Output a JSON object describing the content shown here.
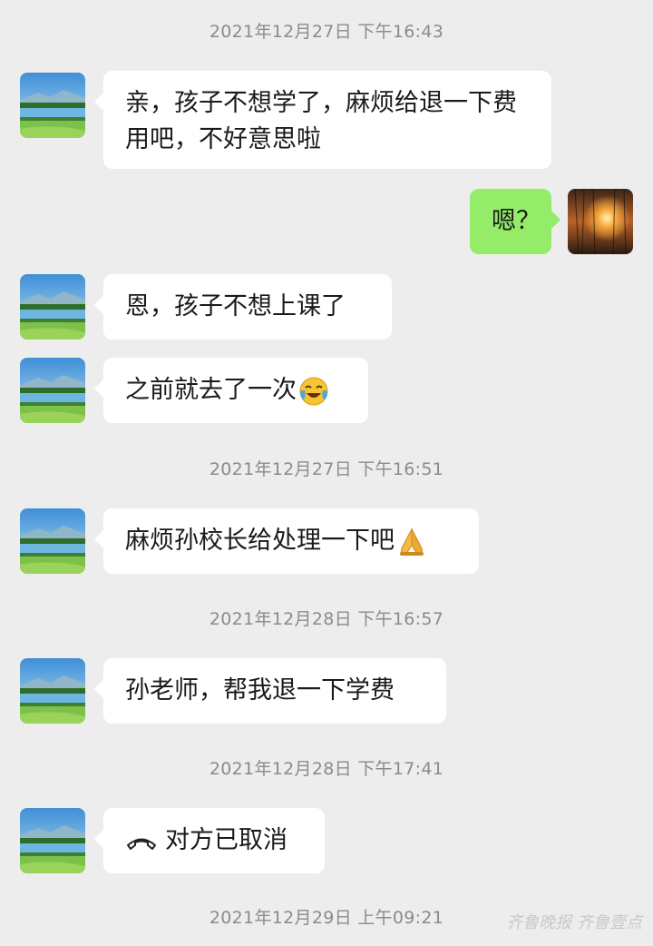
{
  "timestamps": [
    "2021年12月27日 下午16:43",
    "2021年12月27日 下午16:51",
    "2021年12月28日 下午16:57",
    "2021年12月28日 下午17:41",
    "2021年12月29日 上午09:21"
  ],
  "messages": {
    "m1": "亲，孩子不想学了，麻烦给退一下费用吧，不好意思啦",
    "m2": "嗯？",
    "m3": "恩，孩子不想上课了",
    "m4": "之前就去了一次",
    "m5": "麻烦孙校长给处理一下吧",
    "m6": "孙老师，帮我退一下学费",
    "m7": "对方已取消"
  },
  "icons": {
    "m4_emoji": "crying-laughing-emoji-icon",
    "m5_emoji": "praying-hands-emoji-icon",
    "m7_icon": "phone-hangup-icon"
  },
  "watermark": "齐鲁晚报 齐鲁壹点",
  "colors": {
    "background": "#ededed",
    "incoming_bubble": "#ffffff",
    "outgoing_bubble": "#95ec69",
    "timestamp": "#8b8b8b"
  }
}
